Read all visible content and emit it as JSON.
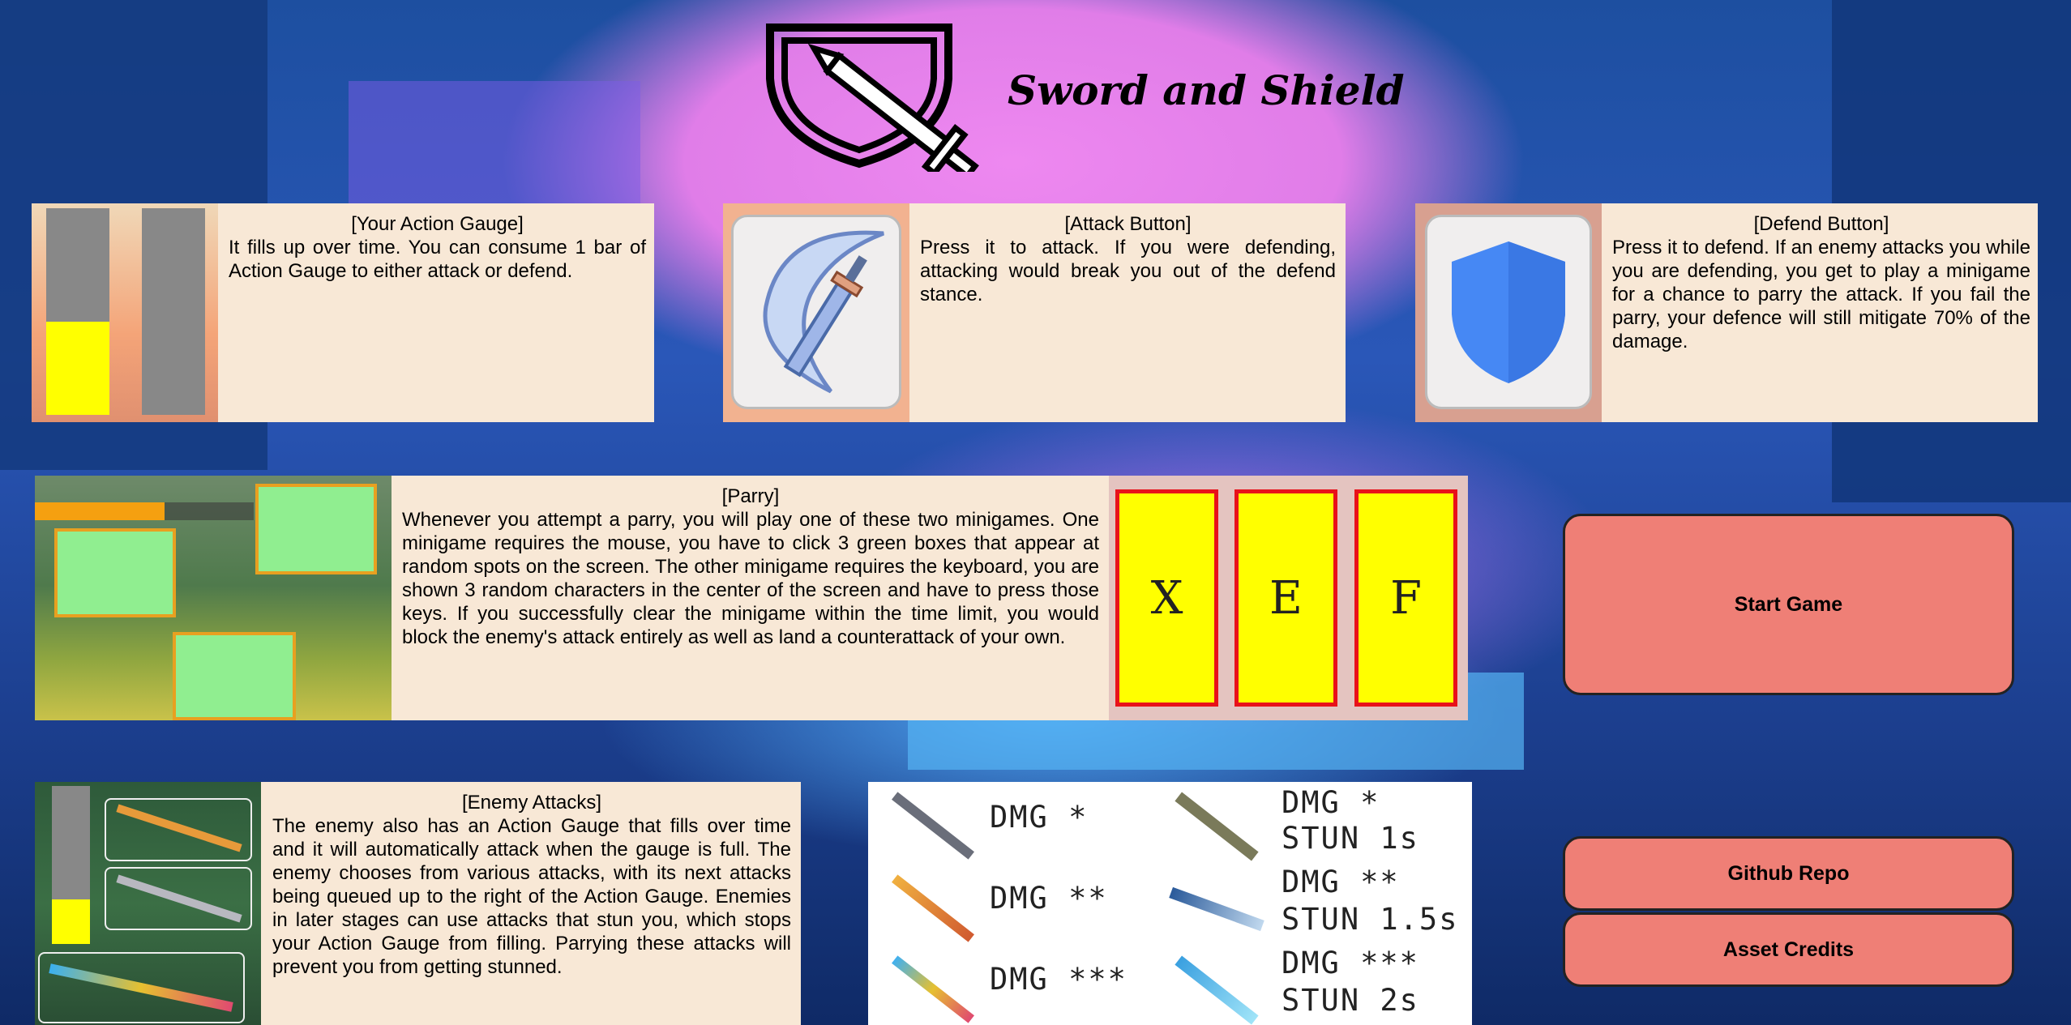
{
  "title": "Sword and Shield",
  "panels": {
    "action_gauge": {
      "title": "[Your Action Gauge]",
      "text": "It fills up over time. You can consume 1 bar of Action Gauge to either attack or defend."
    },
    "attack": {
      "title": "[Attack Button]",
      "text": "Press it to attack. If you were defending, attacking would break you out of the defend stance."
    },
    "defend": {
      "title": "[Defend Button]",
      "text": "Press it to defend. If an enemy attacks you while you are defending, you get to play a minigame for a chance to parry the attack. If you fail the parry, your defence will still mitigate 70% of the damage."
    },
    "parry": {
      "title": "[Parry]",
      "text": "Whenever you attempt a parry, you will play one of these two minigames. One minigame requires the mouse, you have to click 3 green boxes that appear at random spots on the screen. The other minigame requires the keyboard, you are shown 3 random characters in the center of the screen and have to press those keys. If you successfully clear the minigame within the time limit, you would block the enemy's attack entirely as well as land a counterattack of your own.",
      "keys": [
        "X",
        "E",
        "F"
      ]
    },
    "enemy": {
      "title": "[Enemy Attacks]",
      "text": "The enemy also has an Action Gauge that fills over time and it will automatically attack when the gauge is full. The enemy chooses from various attacks, with its next attacks being queued up to the right of the Action Gauge. Enemies in later stages can use attacks that stun you, which stops your Action Gauge from filling. Parrying these attacks will prevent you from getting stunned."
    }
  },
  "gauge_levels": {
    "player_bar_1": 0.45,
    "player_bar_2": 0.0,
    "enemy_bar": 0.28
  },
  "attacks_table": [
    {
      "dmg": "DMG *",
      "stun": ""
    },
    {
      "dmg": "DMG *",
      "stun": "STUN 1s"
    },
    {
      "dmg": "DMG **",
      "stun": ""
    },
    {
      "dmg": "DMG **",
      "stun": "STUN 1.5s"
    },
    {
      "dmg": "DMG ***",
      "stun": ""
    },
    {
      "dmg": "DMG ***",
      "stun": "STUN 2s"
    }
  ],
  "buttons": {
    "start": "Start Game",
    "github": "Github Repo",
    "credits": "Asset Credits"
  },
  "colors": {
    "panel_bg": "#f8e8d6",
    "button_bg": "#ef7f76",
    "gauge_fill": "#ffff00",
    "gauge_empty": "#888888",
    "parry_box": "#90ee90",
    "key_border": "#e8121a"
  }
}
